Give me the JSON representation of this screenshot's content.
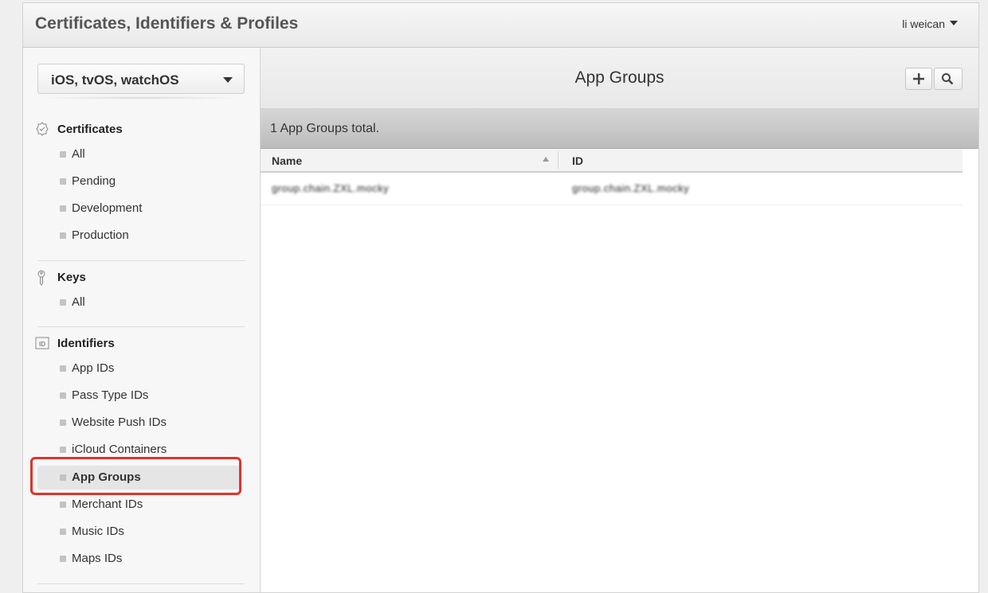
{
  "header": {
    "title": "Certificates, Identifiers & Profiles",
    "user": "li weican"
  },
  "sidebar": {
    "platform": "iOS, tvOS, watchOS",
    "sections": [
      {
        "title": "Certificates",
        "icon": "certificate-icon",
        "items": [
          "All",
          "Pending",
          "Development",
          "Production"
        ]
      },
      {
        "title": "Keys",
        "icon": "key-icon",
        "items": [
          "All"
        ]
      },
      {
        "title": "Identifiers",
        "icon": "id-icon",
        "items": [
          "App IDs",
          "Pass Type IDs",
          "Website Push IDs",
          "iCloud Containers",
          "App Groups",
          "Merchant IDs",
          "Music IDs",
          "Maps IDs"
        ]
      }
    ],
    "active_item": "App Groups"
  },
  "main": {
    "title": "App Groups",
    "summary": "1  App Groups total.",
    "columns": {
      "name": "Name",
      "id": "ID"
    },
    "rows": [
      {
        "name": "group.chain.ZXL.mocky",
        "id": "group.chain.ZXL.mocky"
      }
    ]
  },
  "colors": {
    "highlight": "#e0322b",
    "summary_bar": "#c9c9c9"
  }
}
